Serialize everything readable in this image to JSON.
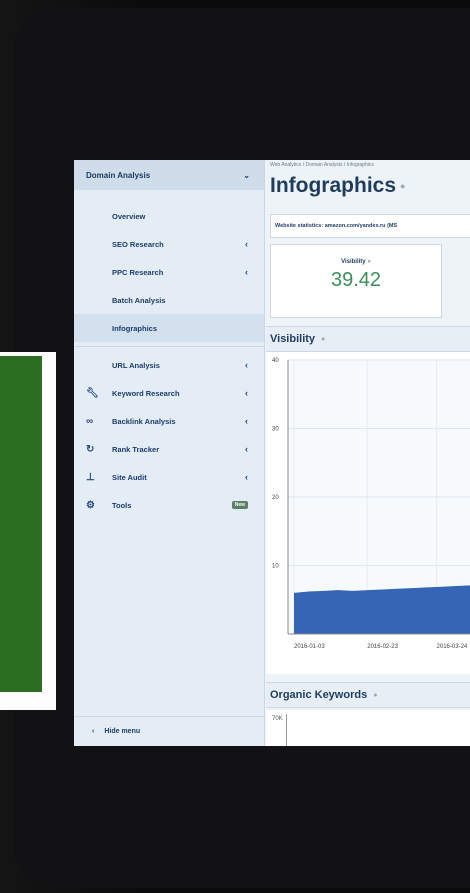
{
  "sidebar": {
    "header": "Domain Analysis",
    "sub_items": [
      {
        "label": "Overview",
        "chevron": ""
      },
      {
        "label": "SEO Research",
        "chevron": "‹"
      },
      {
        "label": "PPC Research",
        "chevron": "‹"
      },
      {
        "label": "Batch Analysis",
        "chevron": ""
      },
      {
        "label": "Infographics",
        "chevron": ""
      }
    ],
    "url_analysis": {
      "label": "URL Analysis",
      "chevron": "‹"
    },
    "tools": [
      {
        "label": "Keyword Research",
        "icon": "wrench-icon",
        "chevron": "‹"
      },
      {
        "label": "Backlink Analysis",
        "icon": "link-icon",
        "chevron": "‹"
      },
      {
        "label": "Rank Tracker",
        "icon": "refresh-icon",
        "chevron": "‹"
      },
      {
        "label": "Site Audit",
        "icon": "sitemap-icon",
        "chevron": "‹"
      },
      {
        "label": "Tools",
        "icon": "gear-icon",
        "badge": "New"
      }
    ],
    "hide_menu": "Hide menu"
  },
  "main": {
    "breadcrumb": "Web Analytics / Domain Analysis / Infographics",
    "title": "Infographics",
    "stats_line": "Website statistics: amazon.com/yandex.ru (MS",
    "visibility_label": "Visibility",
    "visibility_value": "39.42",
    "section_visibility": "Visibility",
    "section_keywords": "Organic Keywords",
    "kw_tick": "70K"
  },
  "colors": {
    "accent_blue": "#2a5db0",
    "value_green": "#3a8f5a",
    "sidebar_bg": "#e4edf6"
  },
  "chart_data": {
    "type": "area",
    "x": [
      "2016-01-03",
      "2016-02-23",
      "2016-03-24"
    ],
    "x_positions": [
      0,
      0.37,
      0.72
    ],
    "series": [
      {
        "values": [
          6,
          6.2,
          6.3,
          6.4,
          6.3,
          6.4,
          6.5,
          6.6,
          6.7,
          6.8,
          6.9,
          7.0,
          7.1,
          7.2
        ]
      }
    ],
    "yticks": [
      10,
      20,
      30,
      40
    ],
    "ylim": [
      0,
      40
    ],
    "grid": true
  }
}
